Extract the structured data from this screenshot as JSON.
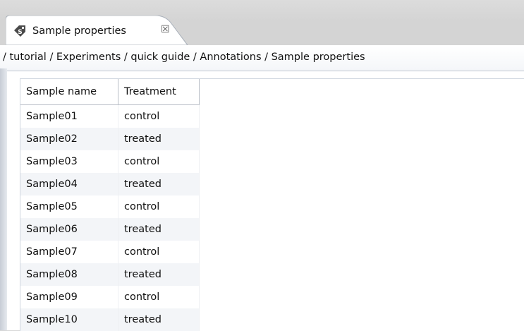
{
  "tab": {
    "label": "Sample properties",
    "icon": "sample-tag-icon",
    "close_glyph": "☒"
  },
  "path": "/ tutorial / Experiments / quick guide / Annotations / Sample properties",
  "table": {
    "headers": [
      "Sample name",
      "Treatment"
    ],
    "rows": [
      [
        "Sample01",
        "control"
      ],
      [
        "Sample02",
        "treated"
      ],
      [
        "Sample03",
        "control"
      ],
      [
        "Sample04",
        "treated"
      ],
      [
        "Sample05",
        "control"
      ],
      [
        "Sample06",
        "treated"
      ],
      [
        "Sample07",
        "control"
      ],
      [
        "Sample08",
        "treated"
      ],
      [
        "Sample09",
        "control"
      ],
      [
        "Sample10",
        "treated"
      ]
    ]
  }
}
